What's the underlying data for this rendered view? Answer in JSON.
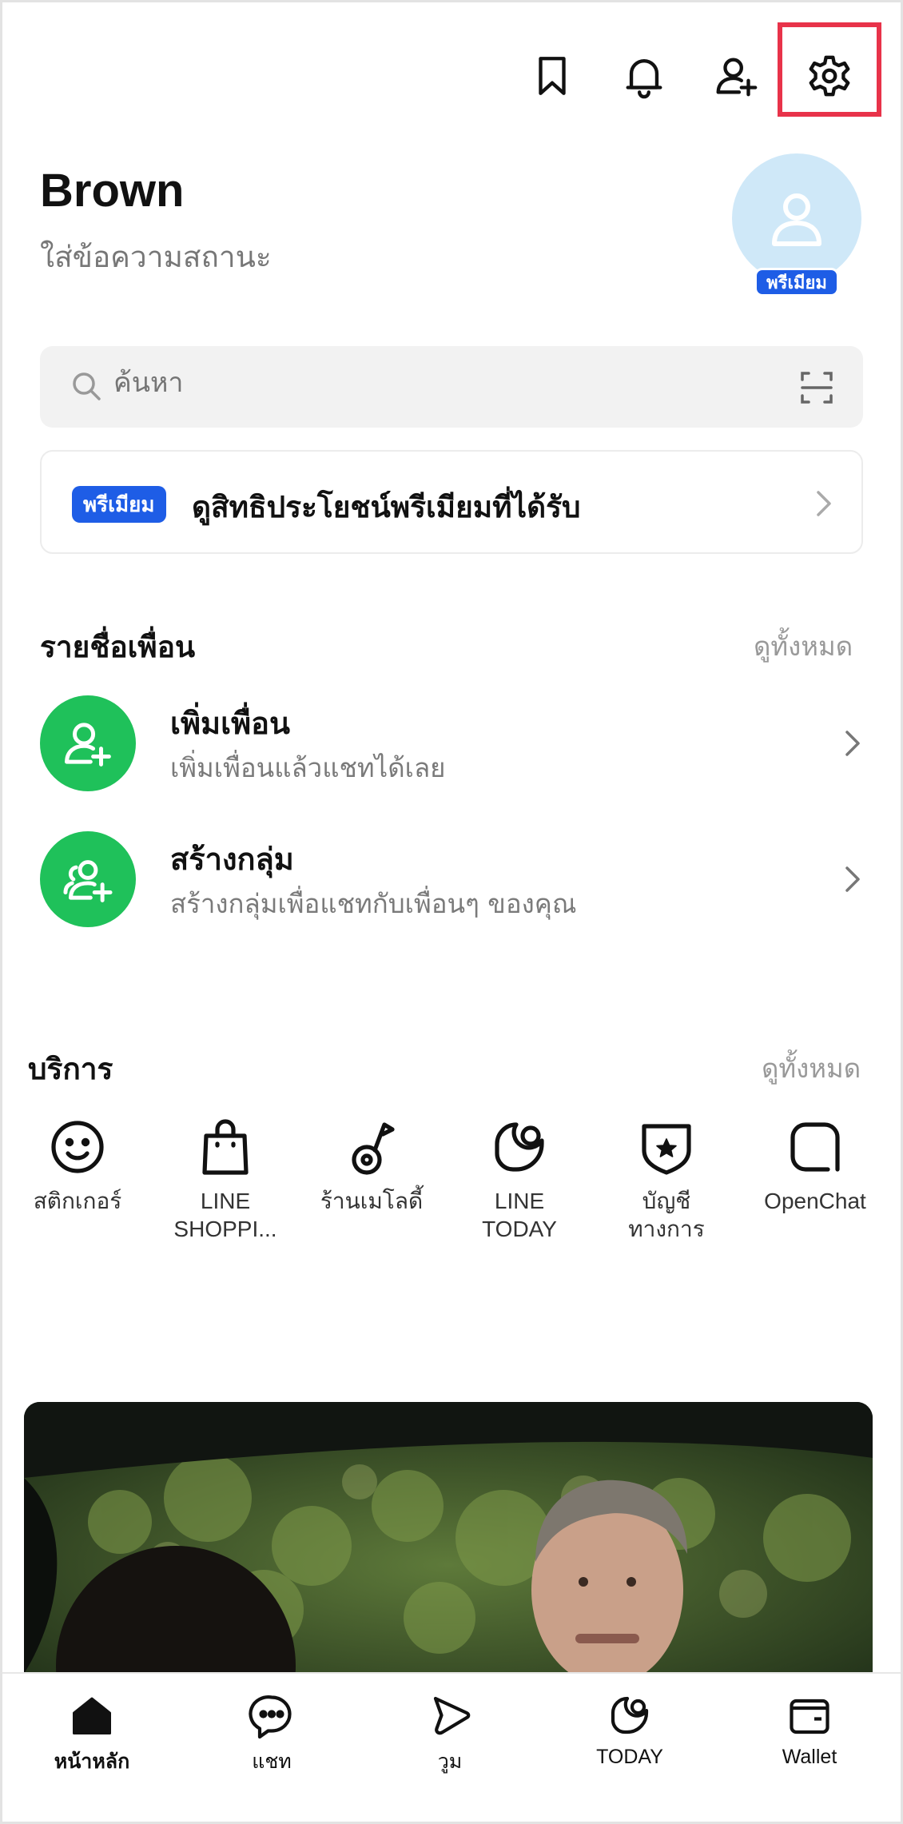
{
  "header": {
    "icons": [
      "bookmark-icon",
      "bell-icon",
      "add-friend-icon",
      "gear-icon"
    ],
    "highlight_color": "#e8334a"
  },
  "profile": {
    "name": "Brown",
    "status_placeholder": "ใส่ข้อความสถานะ",
    "premium_badge": "พรีเมียม"
  },
  "search": {
    "placeholder": "ค้นหา"
  },
  "premium_banner": {
    "tag": "พรีเมียม",
    "text": "ดูสิทธิประโยชน์พรีเมียมที่ได้รับ"
  },
  "friends": {
    "title": "รายชื่อเพื่อน",
    "see_all": "ดูทั้งหมด",
    "rows": [
      {
        "title": "เพิ่มเพื่อน",
        "subtitle": "เพิ่มเพื่อนแล้วแชทได้เลย",
        "icon": "add-friend-icon"
      },
      {
        "title": "สร้างกลุ่ม",
        "subtitle": "สร้างกลุ่มเพื่อแชทกับเพื่อนๆ ของคุณ",
        "icon": "create-group-icon"
      }
    ]
  },
  "services": {
    "title": "บริการ",
    "see_all": "ดูทั้งหมด",
    "items": [
      {
        "line1": "สติกเกอร์",
        "line2": "",
        "icon": "smiley-icon"
      },
      {
        "line1": "LINE",
        "line2": "SHOPPI...",
        "icon": "shopping-bag-icon"
      },
      {
        "line1": "ร้านเมโลดี้",
        "line2": "",
        "icon": "music-note-icon"
      },
      {
        "line1": "LINE",
        "line2": "TODAY",
        "icon": "today-icon"
      },
      {
        "line1": "บัญชี",
        "line2": "ทางการ",
        "icon": "shield-star-icon"
      },
      {
        "line1": "OpenChat",
        "line2": "",
        "icon": "openchat-icon"
      }
    ]
  },
  "bottom_nav": {
    "items": [
      {
        "label": "หน้าหลัก",
        "icon": "home-icon",
        "active": true
      },
      {
        "label": "แชท",
        "icon": "chat-icon",
        "active": false
      },
      {
        "label": "วูม",
        "icon": "voom-icon",
        "active": false
      },
      {
        "label": "TODAY",
        "icon": "today-icon",
        "active": false
      },
      {
        "label": "Wallet",
        "icon": "wallet-icon",
        "active": false
      }
    ]
  },
  "colors": {
    "premium_blue": "#1e5de6",
    "line_green": "#1fc15a",
    "avatar_bg": "#cfe8f8"
  }
}
